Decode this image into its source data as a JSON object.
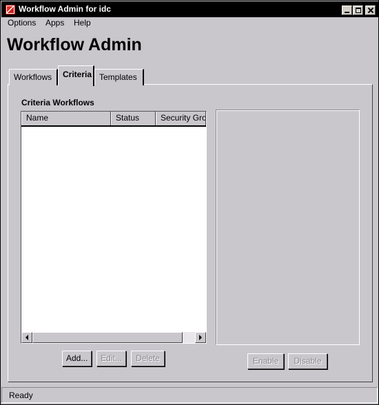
{
  "window": {
    "title": "Workflow Admin for idc",
    "icon": "app-icon",
    "controls": [
      "minimize-icon",
      "maximize-icon",
      "close-icon"
    ]
  },
  "menu": {
    "items": [
      {
        "label": "Options"
      },
      {
        "label": "Apps"
      },
      {
        "label": "Help"
      }
    ]
  },
  "page": {
    "title": "Workflow Admin"
  },
  "tabs": [
    {
      "label": "Workflows",
      "active": false
    },
    {
      "label": "Criteria",
      "active": true
    },
    {
      "label": "Templates",
      "active": false
    }
  ],
  "criteria": {
    "section_label": "Criteria Workflows",
    "table": {
      "columns": [
        "Name",
        "Status",
        "Security Gro"
      ],
      "rows": []
    },
    "buttons": {
      "add": "Add...",
      "edit": "Edit...",
      "delete": "Delete",
      "enable": "Enable",
      "disable": "Disable"
    }
  },
  "status": {
    "text": "Ready"
  },
  "colors": {
    "titlebar": "#000000",
    "background": "#c9c6cc",
    "disabled_text": "#8a888e"
  }
}
